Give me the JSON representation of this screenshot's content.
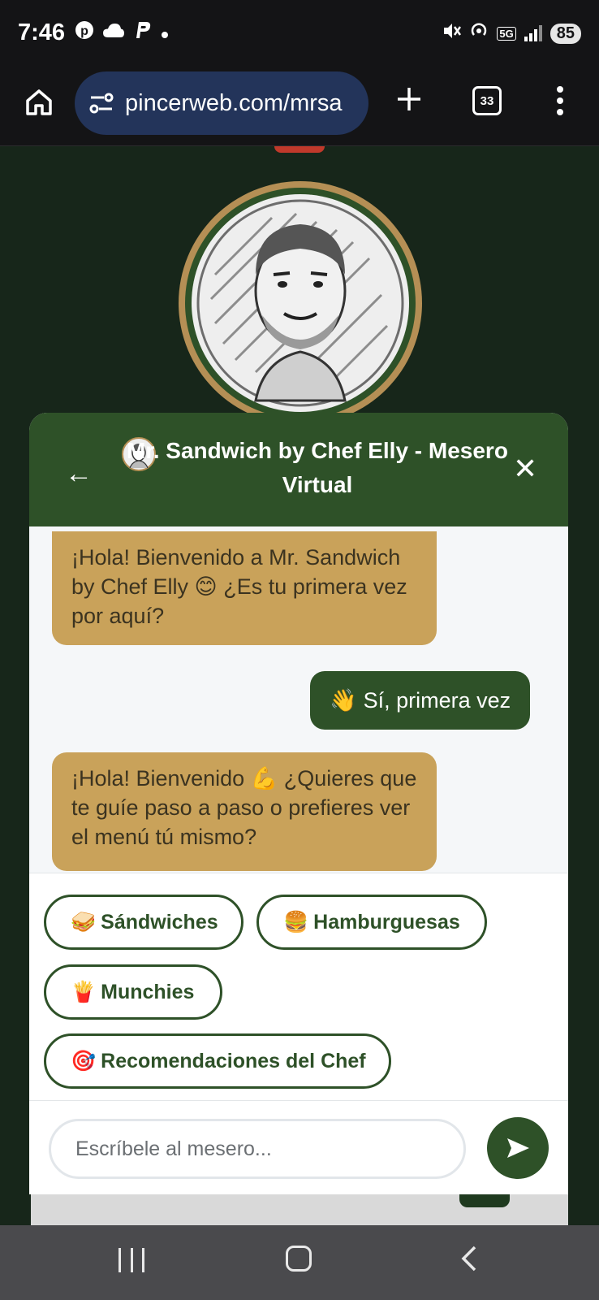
{
  "status_bar": {
    "time": "7:46",
    "battery": "85",
    "network": "5G"
  },
  "browser": {
    "url": "pincerweb.com/mrsa",
    "tab_count": "33"
  },
  "chat": {
    "header": {
      "back_icon": "←",
      "title": "Mr. Sandwich by Chef Elly - Mesero Virtual",
      "close_icon": "✕"
    },
    "messages": [
      {
        "from": "bot",
        "text": "¡Hola! Bienvenido a Mr. Sandwich by Chef Elly 😊 ¿Es tu primera vez por aquí?"
      },
      {
        "from": "user",
        "emoji": "👋",
        "text": "Sí, primera vez"
      },
      {
        "from": "bot",
        "text": "¡Hola! Bienvenido 💪 ¿Quieres que te guíe paso a paso o prefieres ver el menú tú mismo?"
      }
    ],
    "options": [
      {
        "emoji": "🥪",
        "label": "Sándwiches"
      },
      {
        "emoji": "🍔",
        "label": "Hamburguesas"
      },
      {
        "emoji": "🍟",
        "label": "Munchies"
      },
      {
        "emoji": "🎯",
        "label": "Recomendaciones del Chef"
      }
    ],
    "input": {
      "placeholder": "Escríbele al mesero..."
    }
  },
  "colors": {
    "header_green": "#2e5128",
    "bot_bubble": "#c9a25a",
    "url_bar": "#23345a"
  }
}
